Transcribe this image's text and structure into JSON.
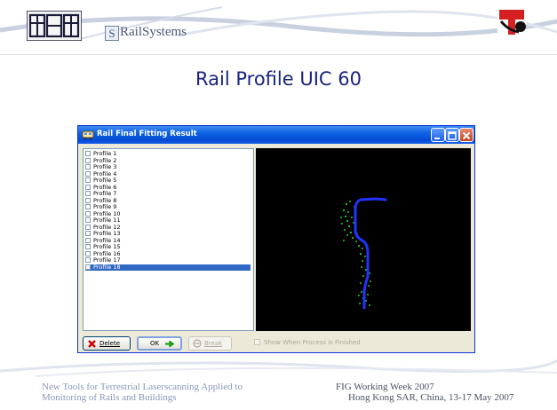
{
  "header": {
    "brand_prefix": "S",
    "brand_rest": "RailSystems"
  },
  "slide": {
    "title": "Rail Profile UIC 60"
  },
  "window": {
    "title": "Rail Final Fitting Result",
    "profiles": [
      "Profile 1",
      "Profile 2",
      "Profile 3",
      "Profile 4",
      "Profile 5",
      "Profile 6",
      "Profile 7",
      "Profile 8",
      "Profile 9",
      "Profile 10",
      "Profile 11",
      "Profile 12",
      "Profile 13",
      "Profile 14",
      "Profile 15",
      "Profile 16",
      "Profile 17",
      "Profile 18"
    ],
    "selected_profile": "Profile 18",
    "buttons": {
      "delete": "Delete",
      "ok": "OK",
      "break": "Break"
    },
    "show_when_finished": "Show When Process is Finished",
    "colors": {
      "titlebar": "#0a5ee0",
      "selection": "#316ac5",
      "fit_curve": "#2233ff",
      "points": "#22cc22"
    }
  },
  "footer": {
    "left_line1": "New Tools for Terrestrial Laserscanning Applied to",
    "left_line2": "Monitoring of Rails and Buildings",
    "right_line1": "FIG Working Week 2007",
    "right_line2": "Hong Kong SAR, China, 13-17 May 2007"
  }
}
